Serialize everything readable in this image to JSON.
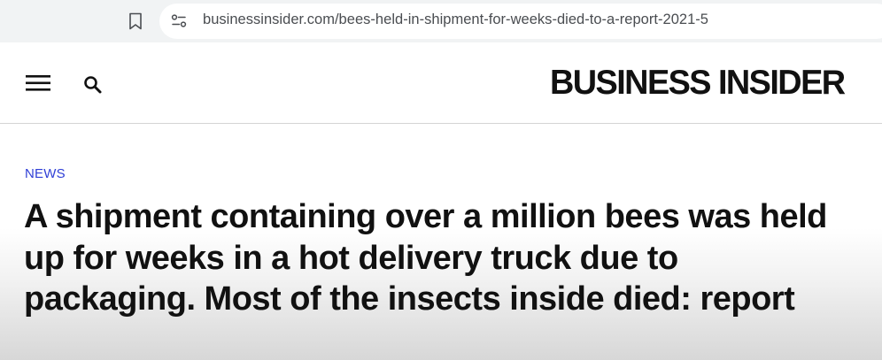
{
  "browser": {
    "url": "businessinsider.com/bees-held-in-shipment-for-weeks-died-to-a-report-2021-5",
    "icons": {
      "bookmark": "bookmark-icon",
      "site_info": "site-settings-icon"
    }
  },
  "header": {
    "logo_text": "BUSINESS INSIDER",
    "icons": {
      "menu": "hamburger-menu-icon",
      "search": "search-icon"
    }
  },
  "article": {
    "category": "NEWS",
    "headline": "A shipment containing over a million bees was held up for weeks in a hot delivery truck due to packaging. Most of the insects inside died: report"
  },
  "colors": {
    "address_bar_bg": "#f1f3f4",
    "category_link": "#2f3fd6",
    "headline_text": "#111111",
    "header_border": "#d4d4d4"
  }
}
